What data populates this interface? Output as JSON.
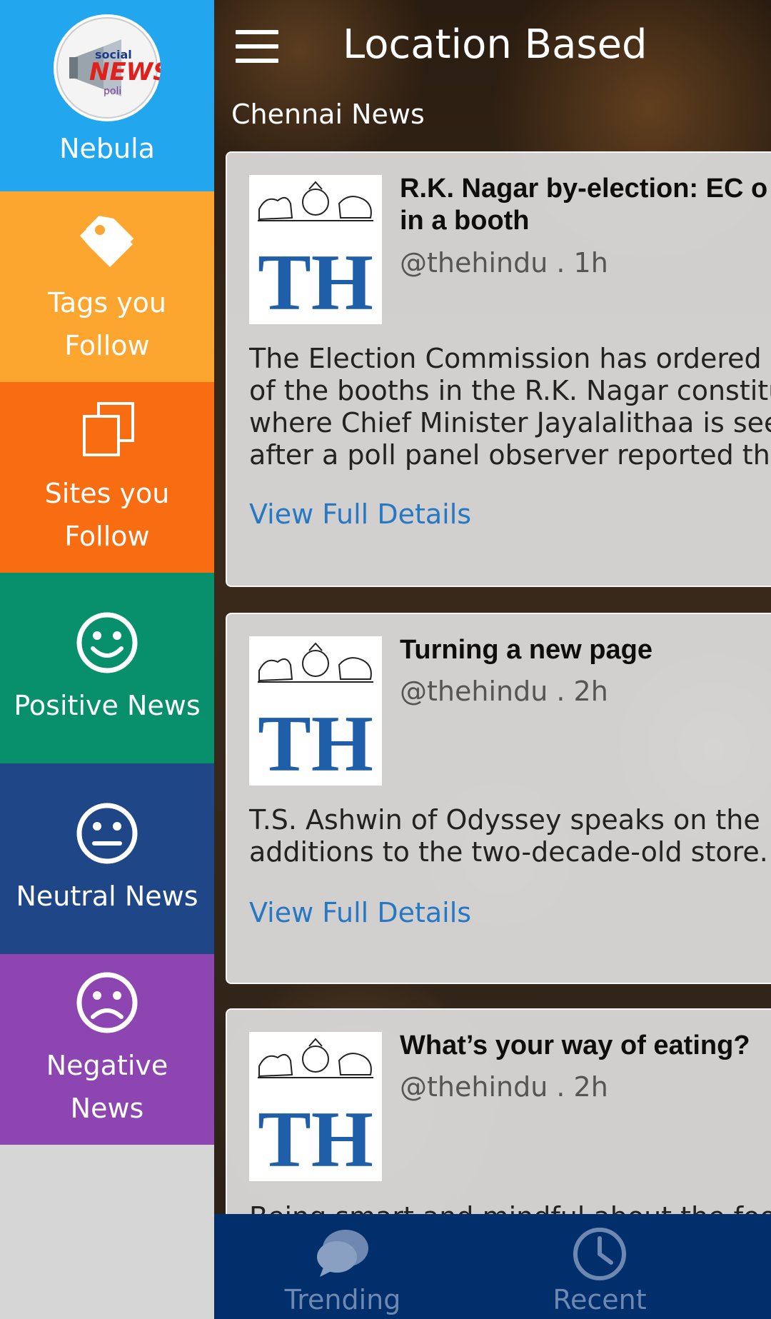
{
  "sidebar": {
    "logo_label": "Nebula",
    "items": [
      {
        "label": "Tags you\nFollow",
        "icon": "tag-icon",
        "color": "#fca52f"
      },
      {
        "label": "Sites you\nFollow",
        "icon": "copy-pages-icon",
        "color": "#f86d12"
      },
      {
        "label": "Positive News",
        "icon": "smile-icon",
        "color": "#08906d"
      },
      {
        "label": "Neutral News",
        "icon": "neutral-face-icon",
        "color": "#1f4687"
      },
      {
        "label": "Negative\nNews",
        "icon": "frown-icon",
        "color": "#8d45b1"
      }
    ],
    "logo_color": "#22a7ee"
  },
  "header": {
    "title": "Location Based",
    "section": "Chennai News"
  },
  "articles": [
    {
      "source_logo": "TH",
      "headline": "R.K. Nagar by-election: EC o\nin a booth",
      "meta": "@thehindu . 1h",
      "body": "The Election Commission has ordered r\nof the booths in the R.K. Nagar constitu\nwhere Chief Minister Jayalalithaa is see\nafter a poll panel observer reported that",
      "link": "View Full Details"
    },
    {
      "source_logo": "TH",
      "headline": "Turning a new page",
      "meta": "@thehindu . 2h",
      "body": "T.S. Ashwin of Odyssey speaks on the la\nadditions to the two-decade-old store.",
      "link": "View Full Details"
    },
    {
      "source_logo": "TH",
      "headline": "What’s your way of eating?",
      "meta": "@thehindu . 2h",
      "body": "Being smart and mindful about the food",
      "link": ""
    }
  ],
  "bottom_nav": {
    "trending_label": "Trending",
    "recent_label": "Recent",
    "background": "#012f6c"
  },
  "accent_link_color": "#2677c4"
}
